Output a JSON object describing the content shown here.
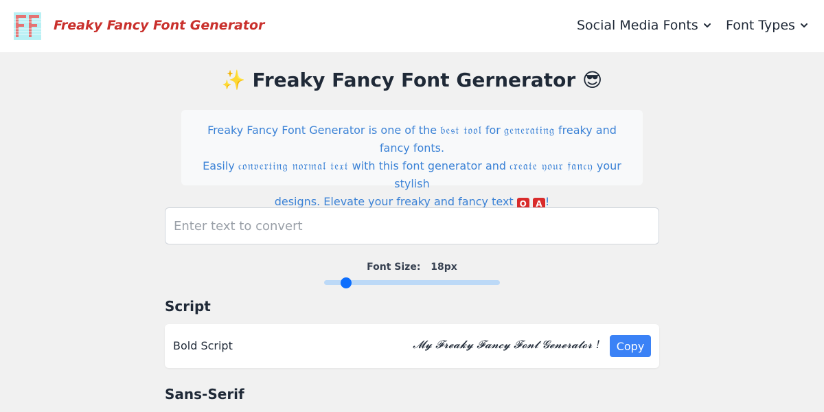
{
  "header": {
    "logo_text": "FF",
    "brand": "Freaky Fancy Font Generator",
    "nav": [
      {
        "label": "Social Media Fonts",
        "icon": "chevron-down-icon"
      },
      {
        "label": "Font Types",
        "icon": "chevron-down-icon"
      }
    ]
  },
  "main": {
    "title_prefix_emoji": "✨",
    "title": "Freaky Fancy Font Gernerator",
    "title_suffix_emoji": "😎",
    "intro": {
      "line1_a": "Freaky Fancy Font Generator is one of the ",
      "line1_glyph1": "𝔟𝔢𝔰𝔱 𝔱𝔬𝔬𝔩",
      "line1_b": " for ",
      "line1_glyph2": "𝔤𝔢𝔫𝔢𝔯𝔞𝔱𝔦𝔫𝔤",
      "line1_c": " freaky and fancy fonts.",
      "line2_a": "Easily ",
      "line2_glyph1": "𝔠𝔬𝔫𝔳𝔢𝔯𝔱𝔦𝔫𝔤 𝔫𝔬𝔯𝔪𝔞𝔩 𝔱𝔢𝔵𝔱",
      "line2_b": " with this font generator and ",
      "line2_glyph2": "𝔠𝔯𝔢𝔞𝔱𝔢 𝔶𝔬𝔲𝔯 𝔣𝔞𝔫𝔠𝔶",
      "line2_c": " your stylish",
      "line3_a": "designs. Elevate your freaky and fancy text ",
      "line3_badge1": "O",
      "line3_badge2": "A",
      "line3_end": "!"
    },
    "input_placeholder": "Enter text to convert",
    "font_size_label": "Font Size:",
    "font_size_value": "18px",
    "font_size_level": 0.1,
    "sections": [
      {
        "title": "Script",
        "rows": [
          {
            "name": "Bold Script",
            "sample": "𝓜𝔂 𝓕𝓻𝓮𝓪𝓴𝔂 𝓕𝓪𝓷𝓬𝔂 𝓕𝓸𝓷𝓽 𝓖𝓮𝓷𝓮𝓻𝓪𝓽𝓸𝓻 !",
            "button": "Copy"
          }
        ]
      },
      {
        "title": "Sans-Serif",
        "rows": []
      }
    ]
  },
  "colors": {
    "brand": "#c9302c",
    "accent": "#3b82f6",
    "intro_text": "#3b82d6",
    "background": "#f1f1f1"
  }
}
